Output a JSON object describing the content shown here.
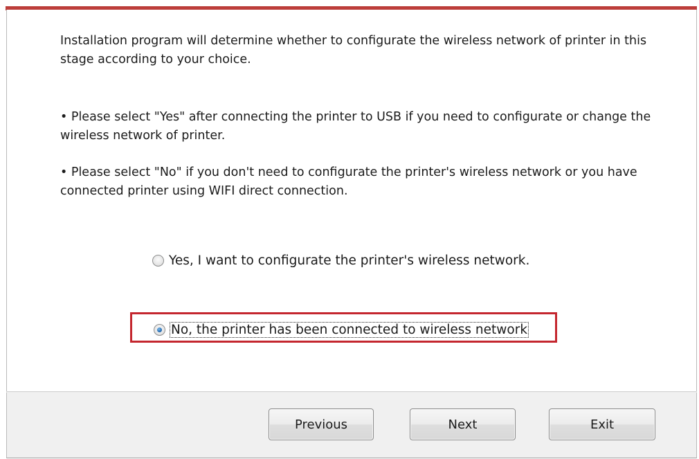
{
  "dialog": {
    "intro_text": "Installation program will determine whether to configurate the wireless network of printer in this stage according to your choice.",
    "bullet_yes": "• Please select \"Yes\" after connecting the printer to USB if you need to configurate or change the wireless network of printer.",
    "bullet_no": "• Please select \"No\" if you don't need to configurate the printer's wireless network or you have connected printer using WIFI direct connection."
  },
  "options": {
    "yes_label": "Yes, I want to configurate the printer's wireless network.",
    "no_label": "No, the printer has been connected to wireless network",
    "selected": "no"
  },
  "buttons": {
    "previous_label": "Previous",
    "next_label": "Next",
    "exit_label": "Exit"
  },
  "colors": {
    "title_bar_accent": "#b83a36",
    "highlight_box": "#c4262e"
  }
}
